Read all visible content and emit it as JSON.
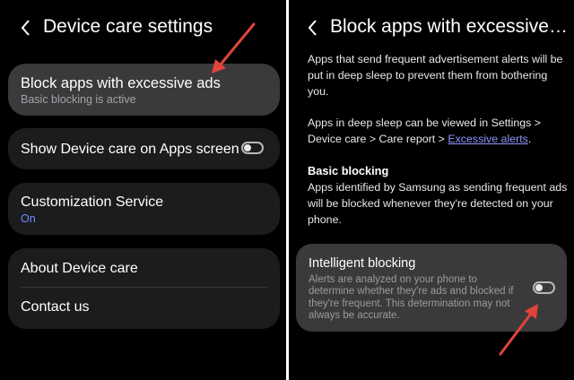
{
  "colors": {
    "background": "#000000",
    "card": "#1c1c1e",
    "card_highlight": "#3a3a3c",
    "subtext": "#a3a3a6",
    "accent_blue": "#6f8cff",
    "link": "#8a96ff",
    "annotation_arrow": "#e0453a"
  },
  "left": {
    "back_icon": "chevron-left-icon",
    "title": "Device care settings",
    "block_ads": {
      "title": "Block apps with excessive ads",
      "subtitle": "Basic blocking is active"
    },
    "show_on_apps": {
      "title": "Show Device care on Apps screen",
      "toggle_on": false
    },
    "customization": {
      "title": "Customization Service",
      "status": "On"
    },
    "about": {
      "title": "About Device care"
    },
    "contact": {
      "title": "Contact us"
    }
  },
  "right": {
    "back_icon": "chevron-left-icon",
    "title": "Block apps with excessive a...",
    "intro": "Apps that send frequent advertisement alerts will be put in deep sleep to prevent them from bothering you.",
    "deep_sleep_text": "Apps in deep sleep can be viewed in Settings > Device care > Care report >",
    "deep_sleep_link": "Excessive alerts",
    "deep_sleep_end": ".",
    "basic_heading": "Basic blocking",
    "basic_text": "Apps identified by Samsung as sending frequent ads will be blocked whenever they're detected on your phone.",
    "intelligent": {
      "title": "Intelligent blocking",
      "description": "Alerts are analyzed on your phone to determine whether they're ads and blocked if they're frequent. This determination may not always be accurate.",
      "toggle_on": false
    }
  }
}
